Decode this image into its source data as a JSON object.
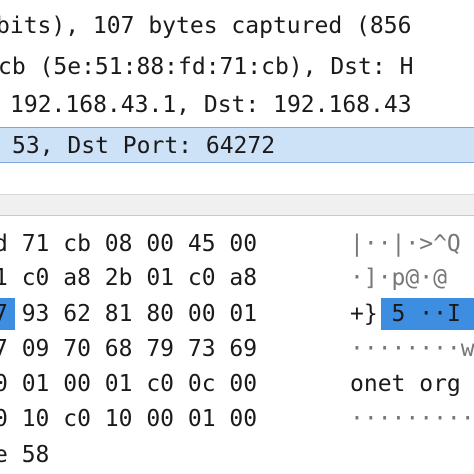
{
  "packet_details": {
    "rows": [
      {
        "text": "bits), 107 bytes captured (856"
      },
      {
        "text": "cb (5e:51:88:fd:71:cb), Dst: H"
      },
      {
        "text": "192.168.43.1, Dst: 192.168.43"
      },
      {
        "text": "53, Dst Port: 64272",
        "selected": true
      }
    ]
  },
  "packet_bytes": {
    "lines": [
      {
        "hex": "d 71 cb 08 00 45 00",
        "ascii": "|··|·>^Q"
      },
      {
        "hex": "1 c0 a8 2b 01 c0 a8",
        "ascii": "·]·p@·@"
      },
      {
        "hex": "7 93 62 81 80 00 01",
        "ascii_prefix": "+}",
        "ascii": " 5 ··I"
      },
      {
        "hex": "7 09 70 68 79 73 69",
        "ascii": "········w"
      },
      {
        "hex": "0 01 00 01 c0 0c 00",
        "ascii": "onet org"
      },
      {
        "hex": "0 10 c0 10 00 01 00",
        "ascii": "·········"
      },
      {
        "hex": "e 58",
        "ascii": ""
      }
    ]
  },
  "colors": {
    "selection_row": "#cde1f7",
    "byte_highlight": "#3d8ee0"
  }
}
